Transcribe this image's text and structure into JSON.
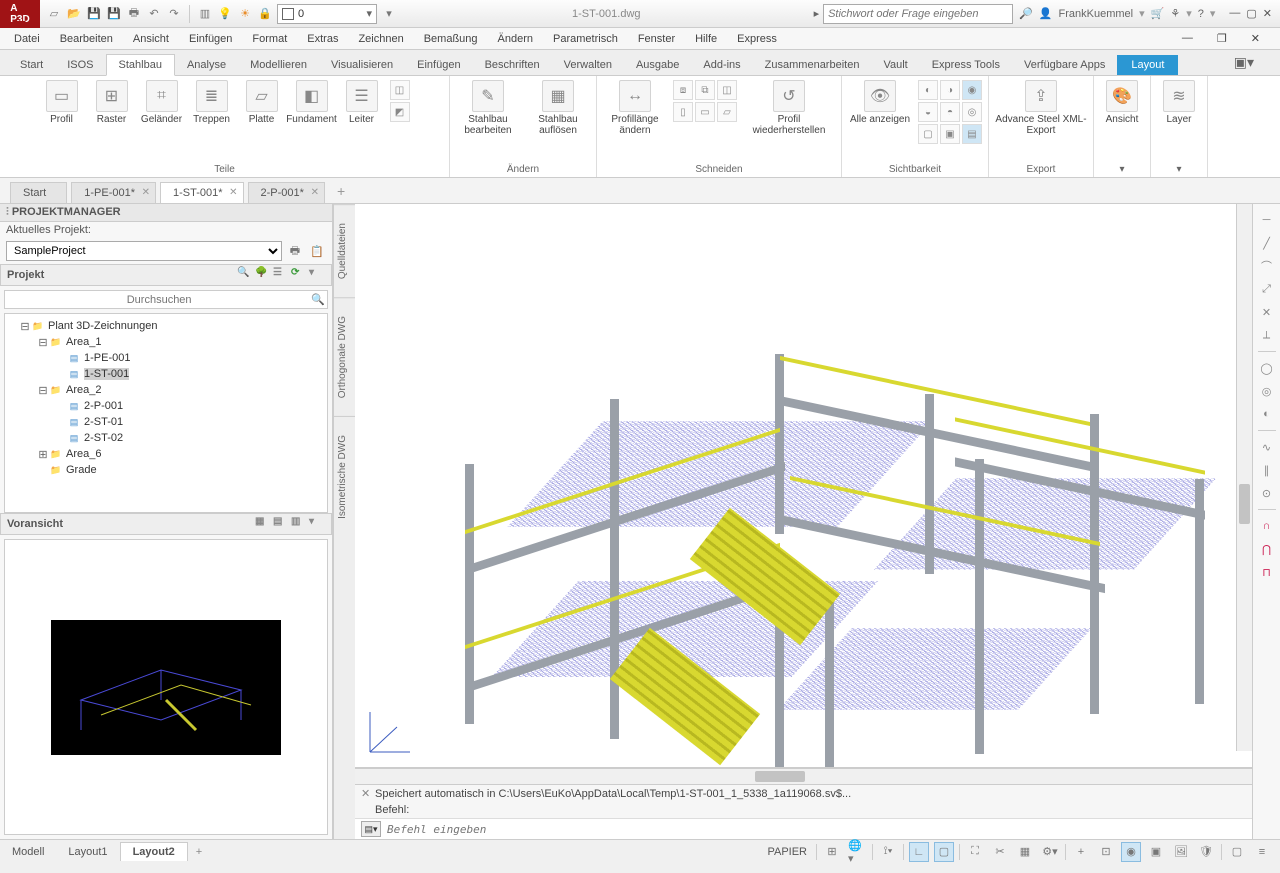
{
  "title": "1-ST-001.dwg",
  "search_placeholder": "Stichwort oder Frage eingeben",
  "user": "FrankKuemmel",
  "layer_value": "0",
  "menu": [
    "Datei",
    "Bearbeiten",
    "Ansicht",
    "Einfügen",
    "Format",
    "Extras",
    "Zeichnen",
    "Bemaßung",
    "Ändern",
    "Parametrisch",
    "Fenster",
    "Hilfe",
    "Express"
  ],
  "ribbon_tabs": [
    "Start",
    "ISOS",
    "Stahlbau",
    "Analyse",
    "Modellieren",
    "Visualisieren",
    "Einfügen",
    "Beschriften",
    "Verwalten",
    "Ausgabe",
    "Add-ins",
    "Zusammenarbeiten",
    "Vault",
    "Express Tools",
    "Verfügbare Apps",
    "Layout"
  ],
  "ribbon_active": "Stahlbau",
  "panels": {
    "teile": {
      "name": "Teile",
      "btns": [
        "Profil",
        "Raster",
        "Geländer",
        "Treppen",
        "Platte",
        "Fundament",
        "Leiter"
      ]
    },
    "aendern": {
      "name": "Ändern",
      "btns": [
        "Stahlbau bearbeiten",
        "Stahlbau auflösen"
      ]
    },
    "schneiden": {
      "name": "Schneiden",
      "btns": [
        "Profillänge ändern",
        "",
        "Profil wiederherstellen"
      ]
    },
    "sicht": {
      "name": "Sichtbarkeit",
      "btn": "Alle anzeigen"
    },
    "export": {
      "name": "Export",
      "btn": "Advance Steel XML-Export"
    },
    "ansicht": "Ansicht",
    "layer": "Layer"
  },
  "doc_tabs": [
    {
      "label": "Start",
      "closable": false
    },
    {
      "label": "1-PE-001*",
      "closable": true
    },
    {
      "label": "1-ST-001*",
      "closable": true,
      "active": true
    },
    {
      "label": "2-P-001*",
      "closable": true
    }
  ],
  "pm": {
    "title": "PROJEKTMANAGER",
    "current_label": "Aktuelles Projekt:",
    "project": "SampleProject",
    "section": "Projekt",
    "search_placeholder": "Durchsuchen",
    "preview_label": "Voransicht"
  },
  "tree": [
    {
      "lvl": 1,
      "exp": "⊟",
      "type": "root",
      "name": "Plant 3D-Zeichnungen"
    },
    {
      "lvl": 2,
      "exp": "⊟",
      "type": "folder",
      "name": "Area_1"
    },
    {
      "lvl": 3,
      "exp": "",
      "type": "dwg",
      "name": "1-PE-001"
    },
    {
      "lvl": 3,
      "exp": "",
      "type": "dwg",
      "name": "1-ST-001",
      "sel": true
    },
    {
      "lvl": 2,
      "exp": "⊟",
      "type": "folder",
      "name": "Area_2"
    },
    {
      "lvl": 3,
      "exp": "",
      "type": "dwg",
      "name": "2-P-001"
    },
    {
      "lvl": 3,
      "exp": "",
      "type": "dwg",
      "name": "2-ST-01"
    },
    {
      "lvl": 3,
      "exp": "",
      "type": "dwg",
      "name": "2-ST-02"
    },
    {
      "lvl": 2,
      "exp": "⊞",
      "type": "folder",
      "name": "Area_6"
    },
    {
      "lvl": 2,
      "exp": "",
      "type": "folder",
      "name": "Grade"
    }
  ],
  "side_tabs": [
    "Quelldateien",
    "Orthogonale DWG",
    "Isometrische DWG"
  ],
  "cmd_log": "Speichert automatisch in C:\\Users\\EuKo\\AppData\\Local\\Temp\\1-ST-001_1_5338_1a119068.sv$...",
  "cmd_prompt": "Befehl:",
  "cmd_placeholder": "Befehl eingeben",
  "bottom_tabs": [
    "Modell",
    "Layout1",
    "Layout2"
  ],
  "bottom_active": "Layout2",
  "status_space": "PAPIER"
}
